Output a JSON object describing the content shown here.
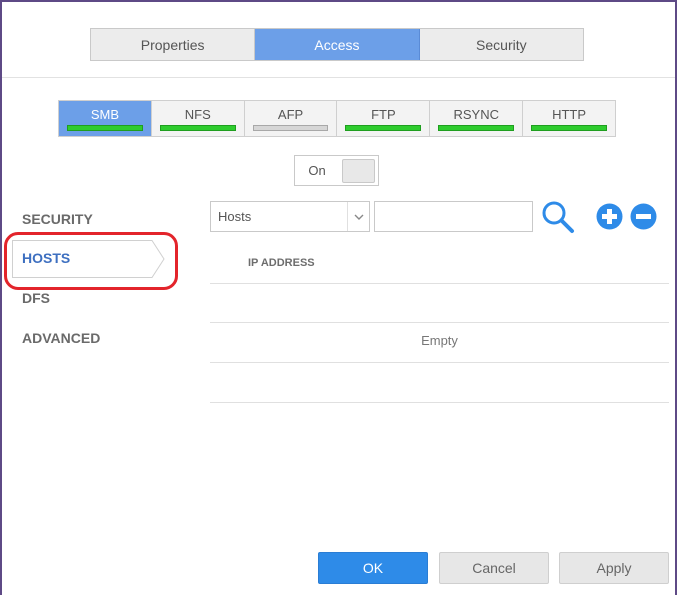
{
  "top_tabs": [
    {
      "label": "Properties",
      "active": false
    },
    {
      "label": "Access",
      "active": true
    },
    {
      "label": "Security",
      "active": false
    }
  ],
  "protocol_tabs": [
    {
      "label": "SMB",
      "active": true,
      "status": "on"
    },
    {
      "label": "NFS",
      "active": false,
      "status": "on"
    },
    {
      "label": "AFP",
      "active": false,
      "status": "off"
    },
    {
      "label": "FTP",
      "active": false,
      "status": "on"
    },
    {
      "label": "RSYNC",
      "active": false,
      "status": "on"
    },
    {
      "label": "HTTP",
      "active": false,
      "status": "on"
    }
  ],
  "toggle": {
    "label": "On"
  },
  "nav": {
    "security": "SECURITY",
    "hosts": "HOSTS",
    "dfs": "DFS",
    "advanced": "ADVANCED"
  },
  "filter": {
    "select_value": "Hosts",
    "search_value": ""
  },
  "table": {
    "header_ip": "IP ADDRESS",
    "empty": "Empty"
  },
  "footer": {
    "ok": "OK",
    "cancel": "Cancel",
    "apply": "Apply"
  },
  "colors": {
    "accent": "#6c9fe8",
    "ok_button": "#2e8be8",
    "status_on": "#2ecc2e",
    "status_off": "#d6d6d6",
    "highlight": "#e3242b"
  },
  "icons": {
    "search": "search-icon",
    "add": "plus-circle-icon",
    "remove": "minus-circle-icon",
    "caret": "chevron-down-icon"
  }
}
